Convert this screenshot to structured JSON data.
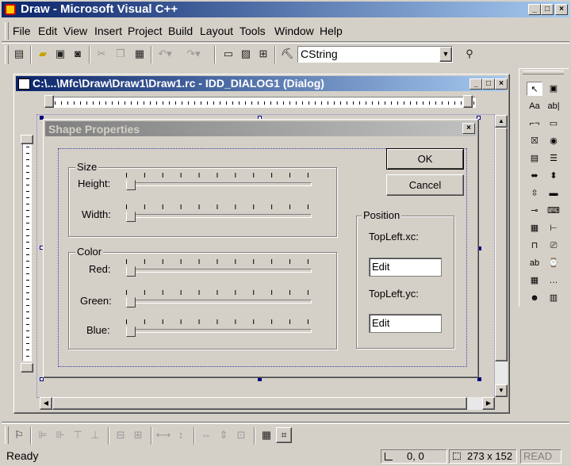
{
  "app": {
    "title": "Draw - Microsoft Visual C++"
  },
  "menu": [
    "File",
    "Edit",
    "View",
    "Insert",
    "Project",
    "Build",
    "Layout",
    "Tools",
    "Window",
    "Help"
  ],
  "toolbar": {
    "combo_value": "CString"
  },
  "editor": {
    "title": "C:\\...\\Mfc\\Draw\\Draw1\\Draw1.rc - IDD_DIALOG1 (Dialog)"
  },
  "dialog": {
    "title": "Shape Properties",
    "ok_label": "OK",
    "cancel_label": "Cancel",
    "size_group": "Size",
    "height_label": "Height:",
    "width_label": "Width:",
    "color_group": "Color",
    "red_label": "Red:",
    "green_label": "Green:",
    "blue_label": "Blue:",
    "position_group": "Position",
    "topleft_xc": "TopLeft.xc:",
    "topleft_yc": "TopLeft.yc:",
    "edit1": "Edit",
    "edit2": "Edit"
  },
  "controls": {
    "items": [
      "pointer",
      "picture",
      "static-text",
      "edit-box",
      "group-box",
      "button",
      "check-box",
      "radio-button",
      "combo-box",
      "list-box",
      "h-scrollbar",
      "v-scrollbar",
      "spin",
      "progress",
      "slider",
      "hot-key",
      "list-control",
      "tree-control",
      "tab-control",
      "animate",
      "rich-edit",
      "date-time",
      "month-calendar",
      "ip-address",
      "custom-control",
      "extended-combo"
    ]
  },
  "status": {
    "text": "Ready",
    "position": "0, 0",
    "size": "273 x 152",
    "mode": "READ"
  },
  "colors": {
    "face": "#d4d0c8",
    "title_start": "#0a246a",
    "title_end": "#a6caf0",
    "selection": "#000080"
  }
}
